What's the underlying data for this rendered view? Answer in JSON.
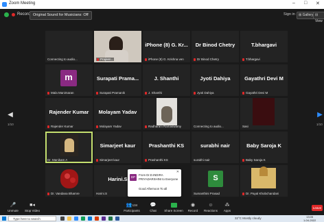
{
  "window": {
    "title": "Zoom Meeting",
    "controls": [
      "–",
      "□",
      "✕"
    ]
  },
  "topbar": {
    "recording_label": "Recording",
    "original_sound": "Original Sound for Musicians: Off",
    "sign_in": "Sign in",
    "gallery": "⊞ Gallery",
    "view": "⊟ View"
  },
  "tiles": [
    {
      "big": "",
      "small": "Connecting to audio..."
    },
    {
      "big": "",
      "small": ""
    },
    {
      "big": "",
      "small": "Prajeen..."
    },
    {
      "big": "iPhone (8) G. Kr...",
      "small": "iPhone (8) G. Krishna ven"
    },
    {
      "big": "Dr Binod Chetry",
      "small": "Dr Binod Chetry"
    },
    {
      "big": "T.bhargavi",
      "small": "T.bhargavi"
    },
    {
      "big": "",
      "small": "",
      "avatar_letter": "m"
    },
    {
      "big": "",
      "small": "Mala Manimaran"
    },
    {
      "big": "Surapati Prama...",
      "small": "Surapati Pramanik"
    },
    {
      "big": "J. Shanthi",
      "small": "J. Shanthi"
    },
    {
      "big": "Jyoti Dahiya",
      "small": "Jyoti Dahiya"
    },
    {
      "big": "Gayathri Devi M",
      "small": "Gayathri Devi M"
    },
    {
      "big": "Rajender Kumar",
      "small": "Rajender Kumar"
    },
    {
      "big": "Molayam Yadav",
      "small": "Molayam Yadav"
    },
    {
      "big": "",
      "small": "Radharani Ramaswamy"
    },
    {
      "big": "",
      "small": "Connecting to audio..."
    },
    {
      "big": "",
      "small": "Sasi"
    },
    {
      "big": "",
      "small": ""
    },
    {
      "big": "",
      "small": "Dr. Manikam A"
    },
    {
      "big": "Simarjeet kaur",
      "small": "Simarjeet kaur"
    },
    {
      "big": "Prashanthi KS",
      "small": "Prashanthi KS"
    },
    {
      "big": "surabhi nair",
      "small": "surabhi nair"
    },
    {
      "big": "Baby Saroja K",
      "small": "Baby Saroja K"
    },
    {
      "big": "",
      "small": "Dr. Vandana Bhamre"
    },
    {
      "big": "Harini.S",
      "small": "Harini.S"
    },
    {
      "big": "",
      "small": ""
    },
    {
      "big": "",
      "small": "Sumanthini Prasad",
      "avatar_letter": "S"
    },
    {
      "big": "",
      "small": "Dr. Payal Khobchandani"
    }
  ],
  "pager": {
    "left_label": "1/10",
    "right_label": "1/10"
  },
  "chat_popup": {
    "avatar_text": "DP",
    "from": "From Dr.D.INDIRA PRIYADARSHINI to Everyone",
    "message": "Good Afternoon To all",
    "close": "✕"
  },
  "toolbar": {
    "unmute": "Unmute",
    "stop_video": "Stop Video",
    "participants": "Participants",
    "participants_count": "134",
    "chat": "Chat",
    "share_screen": "Share Screen",
    "record": "Record",
    "reactions": "Reactions",
    "apps": "Apps",
    "leave": "Leave"
  },
  "taskbar": {
    "search": "Type here to search",
    "weather": "32°C  Mostly cloudy",
    "time": "13:05",
    "date": "1-04-2022"
  },
  "colors": {
    "accent_green": "#2bb24c",
    "active_speaker": "#c5e06f",
    "mic_muted": "#e02828",
    "avatar_purple": "#8a2a82",
    "avatar_green": "#2e8b3c"
  }
}
